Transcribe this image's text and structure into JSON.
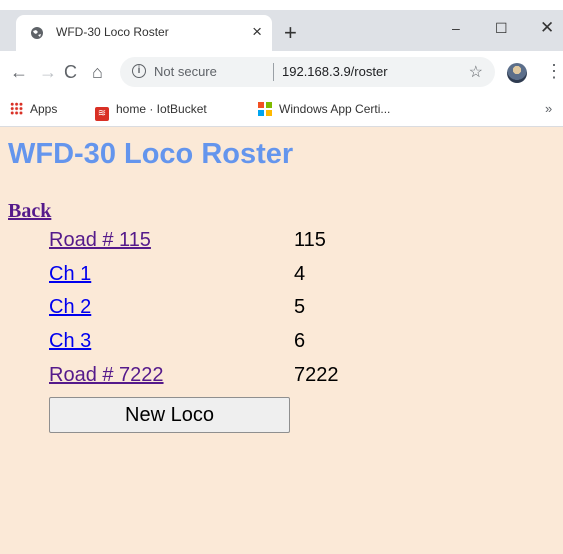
{
  "browser": {
    "tab_title": "WFD-30 Loco Roster",
    "tab_close": "×",
    "new_tab": "+",
    "win_minimize": "–",
    "win_maximize": "☐",
    "win_close": "✕",
    "security_label": "Not secure",
    "url": "192.168.3.9/roster",
    "bookmarks": [
      {
        "label": "Apps"
      },
      {
        "label": "home · IotBucket"
      },
      {
        "label": "Windows App Certi..."
      }
    ],
    "bookmarks_more": "»"
  },
  "page": {
    "title": "WFD-30 Loco Roster",
    "back_label": "Back",
    "roster": [
      {
        "name": "Road # 115",
        "number": "115",
        "visited": true
      },
      {
        "name": "Ch 1",
        "number": "4",
        "visited": false
      },
      {
        "name": "Ch 2",
        "number": "5",
        "visited": false
      },
      {
        "name": "Ch 3",
        "number": "6",
        "visited": false
      },
      {
        "name": "Road # 7222",
        "number": "7222",
        "visited": true
      }
    ],
    "new_loco_label": "New Loco"
  },
  "colors": {
    "page_background": "#fbe9d7",
    "title": "#6495ed",
    "visited_link": "#551a8b",
    "link": "#0000ee"
  }
}
